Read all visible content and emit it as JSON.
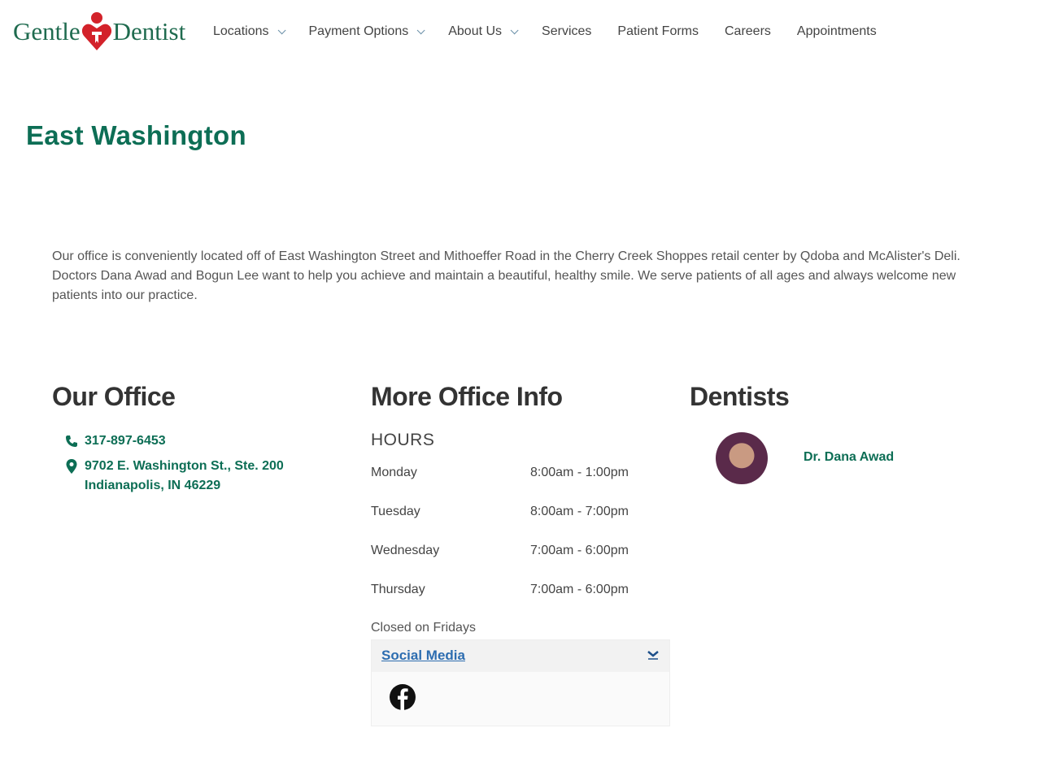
{
  "brand": {
    "logo_left": "Gentle",
    "logo_right": "Dentist",
    "accent": "#0d6e55",
    "logo_red": "#d3222a"
  },
  "nav": [
    {
      "label": "Locations",
      "dropdown": true
    },
    {
      "label": "Payment Options",
      "dropdown": true
    },
    {
      "label": "About Us",
      "dropdown": true
    },
    {
      "label": "Services"
    },
    {
      "label": "Patient Forms"
    },
    {
      "label": "Careers"
    },
    {
      "label": "Appointments"
    }
  ],
  "page": {
    "title": "East Washington",
    "intro": "Our office is conveniently located off of East Washington Street and Mithoeffer Road in the Cherry Creek Shoppes retail center by Qdoba and McAlister's Deli. Doctors Dana Awad and Bogun Lee want to help you achieve and maintain a beautiful, healthy smile. We serve patients of all ages and always welcome new patients into our practice."
  },
  "office": {
    "heading": "Our Office",
    "phone": "317-897-6453",
    "address1": "9702 E. Washington St., Ste. 200",
    "address2": "Indianapolis, IN 46229"
  },
  "info": {
    "heading": "More Office Info",
    "hours_title": "HOURS",
    "hours": [
      {
        "day": "Monday",
        "time": "8:00am - 1:00pm"
      },
      {
        "day": "Tuesday",
        "time": "8:00am - 7:00pm"
      },
      {
        "day": "Wednesday",
        "time": "7:00am - 6:00pm"
      },
      {
        "day": "Thursday",
        "time": "7:00am - 6:00pm"
      }
    ],
    "note": "Closed on Fridays",
    "social_label": "Social Media"
  },
  "dentists": {
    "heading": "Dentists",
    "items": [
      {
        "name": "Dr. Dana Awad"
      }
    ]
  }
}
